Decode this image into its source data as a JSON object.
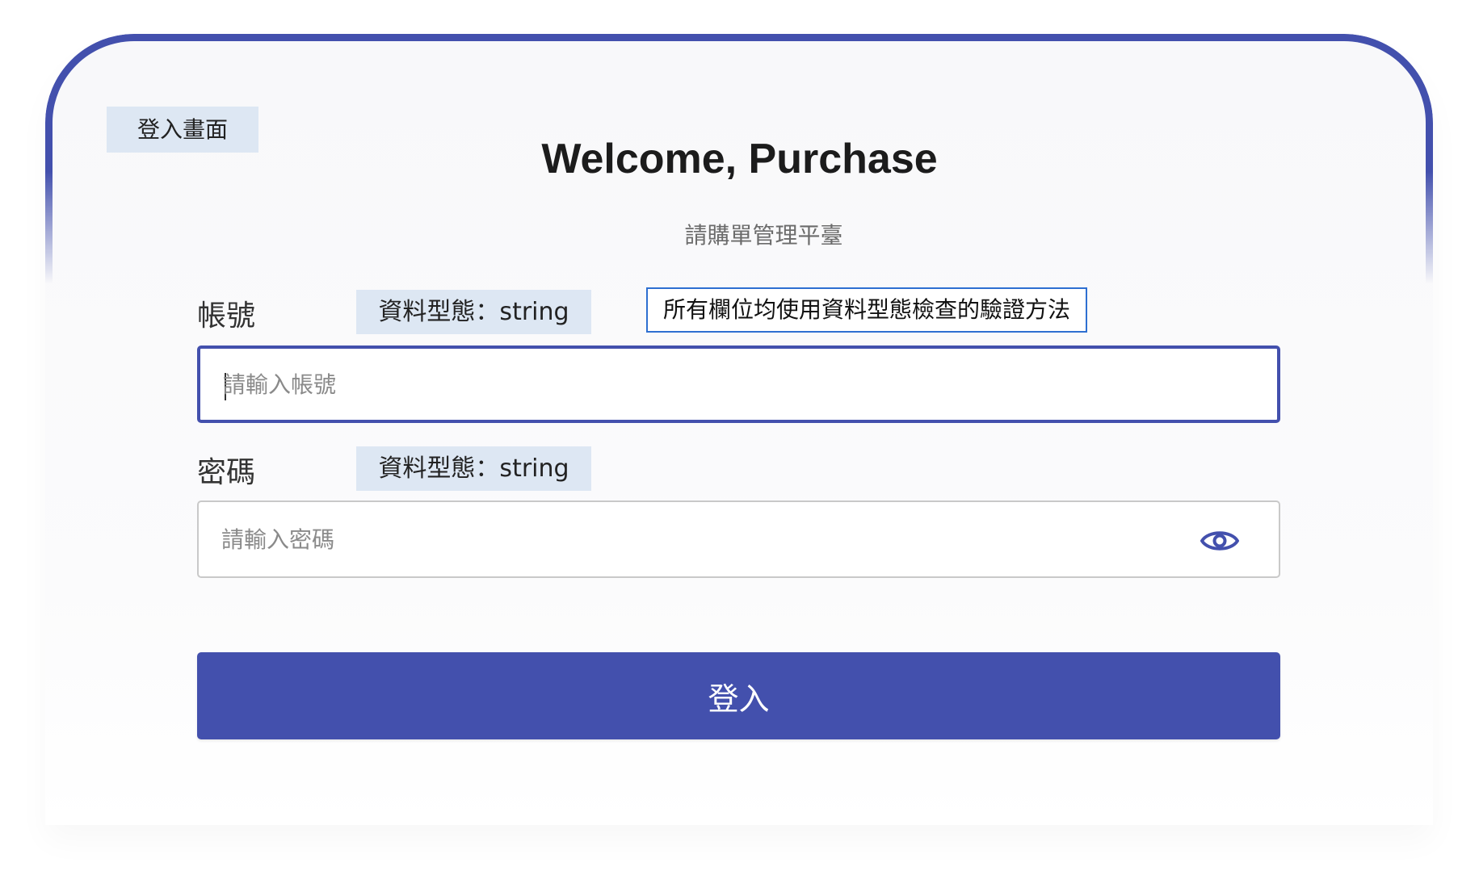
{
  "screen_tag": "登入畫面",
  "header": {
    "title": "Welcome, Purchase",
    "subtitle": "請購單管理平臺"
  },
  "note": "所有欄位均使用資料型態檢查的驗證方法",
  "fields": {
    "account": {
      "label": "帳號",
      "type_tag": "資料型態：string",
      "placeholder": "請輸入帳號",
      "value": ""
    },
    "password": {
      "label": "密碼",
      "type_tag": "資料型態：string",
      "placeholder": "請輸入密碼",
      "value": "",
      "toggle_icon": "eye-icon"
    }
  },
  "login_button": "登入",
  "colors": {
    "primary": "#4350ad",
    "tag_bg": "#dde7f3",
    "note_border": "#2e6fd1"
  }
}
